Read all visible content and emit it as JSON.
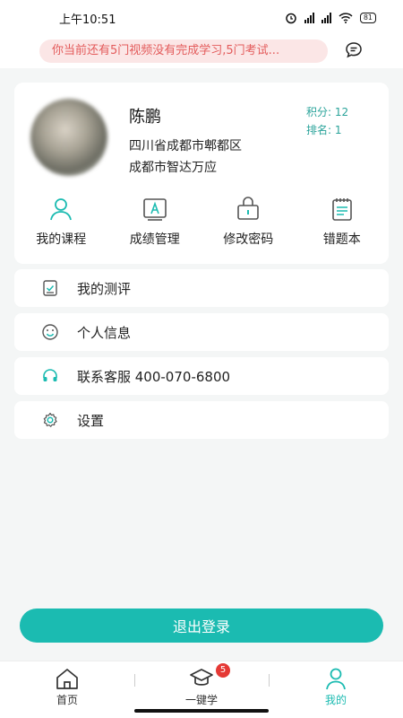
{
  "status_bar": {
    "time": "上午10:51",
    "battery": "81"
  },
  "notice": {
    "text": "你当前还有5门视频没有完成学习,5门考试..."
  },
  "profile": {
    "name": "陈鹏",
    "address_line1": "四川省成都市郫都区",
    "address_line2": "成都市智达万应",
    "points_label": "积分: 12",
    "rank_label": "排名: 1"
  },
  "actions": [
    {
      "label": "我的课程",
      "icon": "user-icon"
    },
    {
      "label": "成绩管理",
      "icon": "grade-icon"
    },
    {
      "label": "修改密码",
      "icon": "lock-icon"
    },
    {
      "label": "错题本",
      "icon": "notebook-icon"
    }
  ],
  "menu": [
    {
      "label": "我的测评",
      "icon": "assessment-icon"
    },
    {
      "label": "个人信息",
      "icon": "smile-icon"
    },
    {
      "label": "联系客服 400-070-6800",
      "icon": "headset-icon"
    },
    {
      "label": "设置",
      "icon": "gear-icon"
    }
  ],
  "logout_label": "退出登录",
  "tabbar": {
    "tabs": [
      {
        "label": "首页",
        "icon": "home-icon"
      },
      {
        "label": "一键学",
        "icon": "graduation-cap-icon",
        "badge": "5"
      },
      {
        "label": "我的",
        "icon": "profile-icon"
      }
    ],
    "active": "我的"
  },
  "colors": {
    "accent": "#1bbbb1",
    "notice_text": "#e35b5b",
    "badge": "#e53935"
  }
}
